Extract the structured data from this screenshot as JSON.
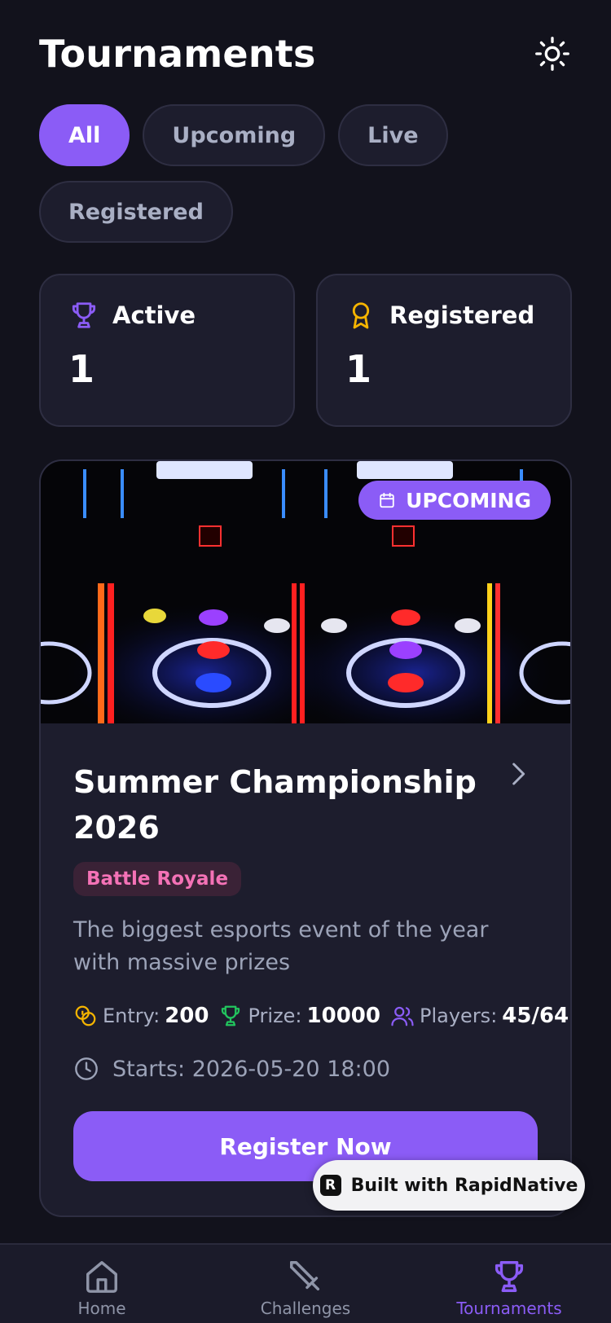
{
  "header": {
    "title": "Tournaments",
    "theme_icon": "sun-icon"
  },
  "filters": [
    {
      "label": "All",
      "active": true
    },
    {
      "label": "Upcoming",
      "active": false
    },
    {
      "label": "Live",
      "active": false
    },
    {
      "label": "Registered",
      "active": false
    }
  ],
  "stats": {
    "active": {
      "label": "Active",
      "value": "1",
      "icon": "trophy-icon",
      "color": "#8b5cf6"
    },
    "registered": {
      "label": "Registered",
      "value": "1",
      "icon": "award-icon",
      "color": "#f5b400"
    }
  },
  "tournament": {
    "status": "UPCOMING",
    "name": "Summer Championship 2026",
    "tag": "Battle Royale",
    "description": "The biggest esports event of the year with massive prizes",
    "entry_label": "Entry:",
    "entry_value": "200",
    "prize_label": "Prize:",
    "prize_value": "10000",
    "players_label": "Players:",
    "players_value": "45/64",
    "starts": "Starts: 2026-05-20 18:00",
    "cta": "Register Now"
  },
  "built_with": "Built with RapidNative",
  "tabbar": [
    {
      "label": "Home",
      "icon": "home-icon",
      "active": false
    },
    {
      "label": "Challenges",
      "icon": "sword-icon",
      "active": false
    },
    {
      "label": "Tournaments",
      "icon": "trophy-icon",
      "active": true
    }
  ],
  "colors": {
    "accent": "#8b5cf6",
    "background": "#12121c",
    "card": "#1d1d2d",
    "tag": "#f472b6"
  }
}
